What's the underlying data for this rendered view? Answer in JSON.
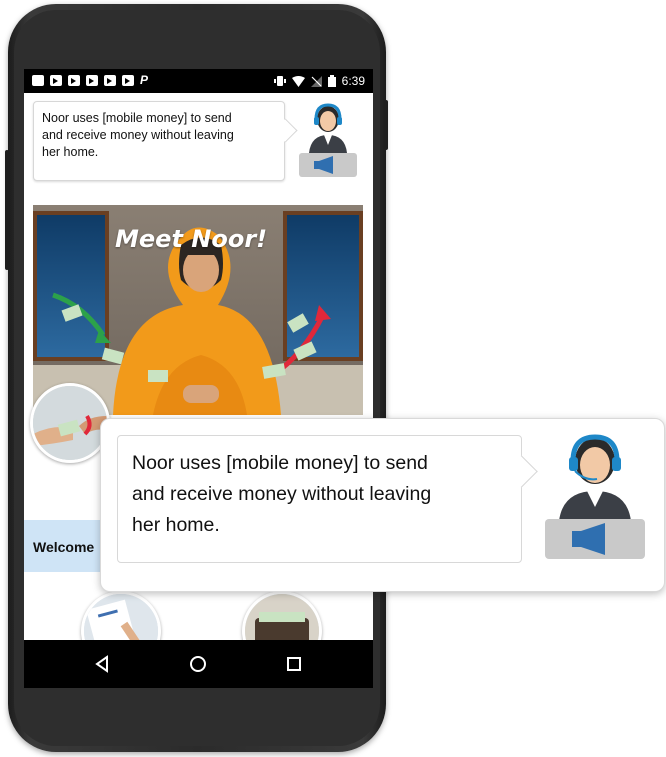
{
  "status_bar": {
    "time": "6:39",
    "left_icons": [
      "image-icon",
      "tv-icon",
      "tv-icon",
      "tv-icon",
      "tv-icon",
      "tv-icon",
      "paypal-icon"
    ],
    "right_icons": [
      "vibrate-icon",
      "wifi-icon",
      "no-sim-icon",
      "battery-icon"
    ]
  },
  "message": {
    "text": "Noor uses [mobile money] to send and receive money without leaving her home."
  },
  "hero": {
    "title": "Meet Noor!"
  },
  "welcome": {
    "text": "Welcome"
  },
  "callout": {
    "text_line1": "Noor uses [mobile money] to send",
    "text_line2": "and receive money without leaving",
    "text_line3": "her home."
  },
  "small_bubble": {
    "line1": "Noor uses [mobile money] to send",
    "line2": "and receive money without leaving",
    "line3": "her home."
  },
  "nav": {
    "buttons": [
      "back-icon",
      "home-icon",
      "recents-icon"
    ]
  },
  "colors": {
    "headset": "#1e88c8",
    "welcome_bg": "#cfe4f6",
    "scarf": "#f29a1a",
    "arrow_green": "#2ca14a",
    "arrow_red": "#e0283a"
  }
}
